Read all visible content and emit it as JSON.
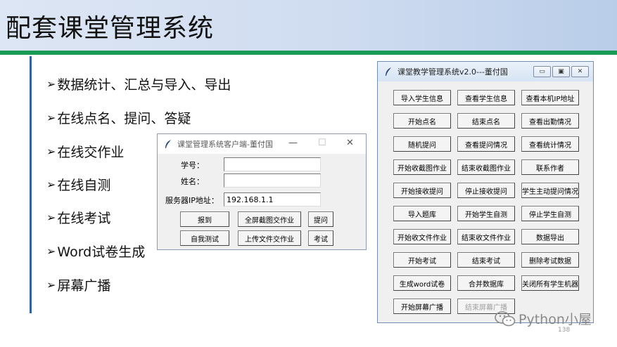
{
  "slide": {
    "title": "配套课堂管理系统",
    "page_number": "138",
    "bullets": [
      "数据统计、汇总与导入、导出",
      "在线点名、提问、答疑",
      "在线交作业",
      "在线自测",
      "在线考试",
      "Word试卷生成",
      "屏幕广播"
    ],
    "bullet_marker": "➢"
  },
  "client_window": {
    "title": "课堂管理系统客户端-董付国",
    "minimize": "—",
    "maximize": "☐",
    "close": "✕",
    "student_id_label": "学号：",
    "student_id_value": "",
    "name_label": "姓名：",
    "name_value": "",
    "server_ip_label": "服务器IP地址：",
    "server_ip_value": "192.168.1.1",
    "buttons": [
      "报到",
      "全屏截图交作业",
      "提问",
      "自我测试",
      "上传文件交作业",
      "考试"
    ]
  },
  "teacher_window": {
    "title": "课堂教学管理系统v2.0---董付国",
    "minimize": "▭",
    "maximize": "▣",
    "close": "✕",
    "buttons": [
      [
        "导入学生信息",
        "查看学生信息",
        "查看本机IP地址"
      ],
      [
        "开始点名",
        "结束点名",
        "查看出勤情况"
      ],
      [
        "随机提问",
        "查看提问情况",
        "查看统计情况"
      ],
      [
        "开始收截图作业",
        "结束收截图作业",
        "联系作者"
      ],
      [
        "开始接收提问",
        "停止接收提问",
        "学生主动提问情况"
      ],
      [
        "导入题库",
        "开始学生自测",
        "停止学生自测"
      ],
      [
        "开始收文件作业",
        "结束收文件作业",
        "数据导出"
      ],
      [
        "开始考试",
        "结束考试",
        "删除考试数据"
      ],
      [
        "生成word试卷",
        "合并数据库",
        "关闭所有学生机器"
      ],
      [
        "开始屏幕广播",
        "结束屏幕广播",
        ""
      ]
    ],
    "disabled_button": "结束屏幕广播"
  },
  "watermark": {
    "text": "Python小屋",
    "icon": "wechat-icon"
  },
  "colors": {
    "header_rule": "#1b9a55",
    "side_rule": "#2f63a8"
  }
}
